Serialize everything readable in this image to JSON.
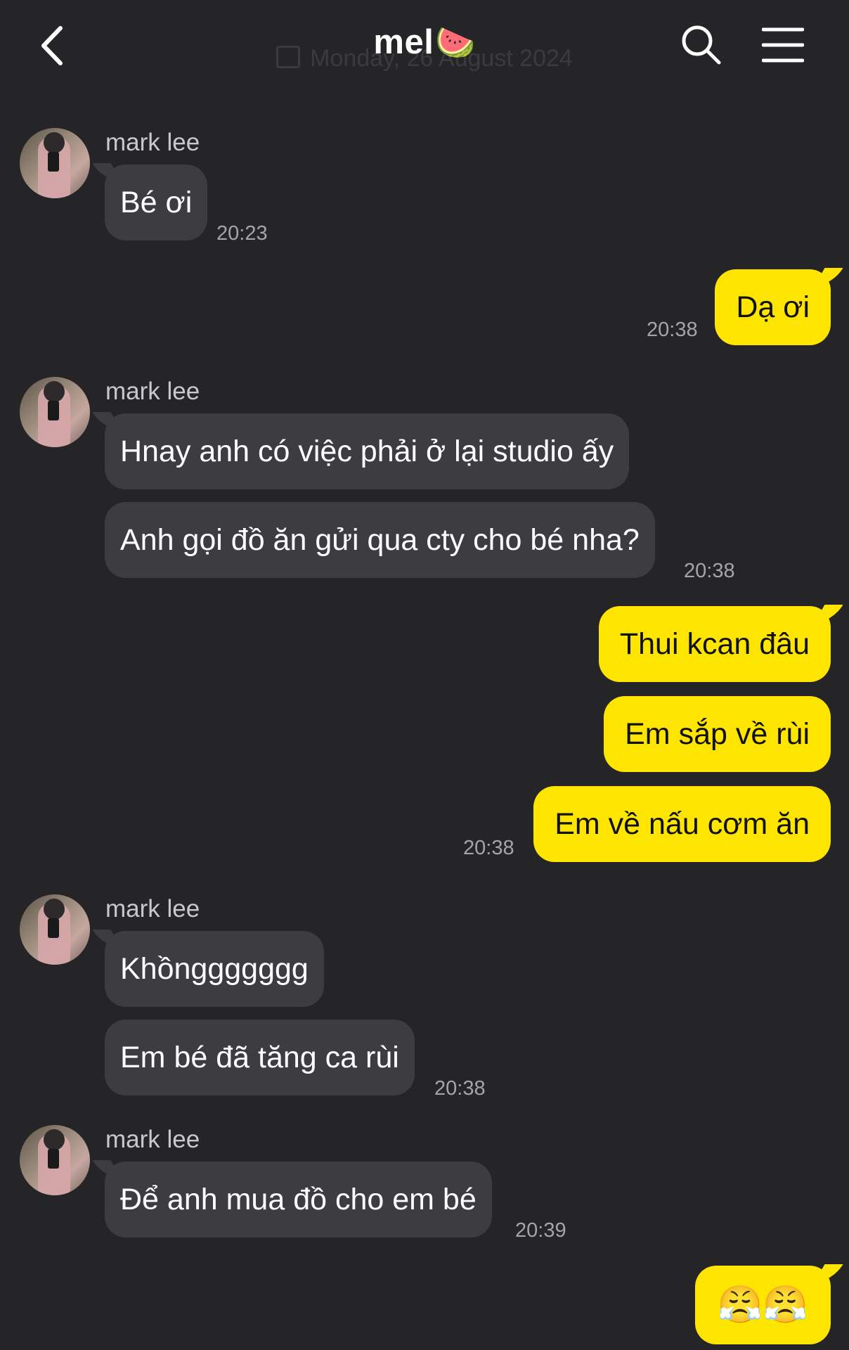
{
  "header": {
    "title": "mel",
    "title_emoji": "🍉",
    "date_divider": "Monday, 26 August 2024",
    "back_icon": "chevron-left-icon",
    "search_icon": "search-icon",
    "menu_icon": "hamburger-menu-icon"
  },
  "colors": {
    "background": "#252528",
    "incoming_bubble": "#3d3d41",
    "outgoing_bubble": "#fde500"
  },
  "messages": [
    {
      "direction": "in",
      "sender": "mark lee",
      "texts": [
        "Bé ơi"
      ],
      "time": "20:23"
    },
    {
      "direction": "out",
      "texts": [
        "Dạ ơi"
      ],
      "time": "20:38"
    },
    {
      "direction": "in",
      "sender": "mark lee",
      "texts": [
        "Hnay anh có việc phải ở lại studio ấy",
        "Anh gọi đồ ăn gửi qua cty cho bé nha?"
      ],
      "time": "20:38"
    },
    {
      "direction": "out",
      "texts": [
        "Thui kcan đâu",
        "Em sắp về rùi",
        "Em về nấu cơm ăn"
      ],
      "time": "20:38"
    },
    {
      "direction": "in",
      "sender": "mark lee",
      "texts": [
        "Khồnggggggg",
        "Em bé đã tăng ca rùi"
      ],
      "time": "20:38"
    },
    {
      "direction": "in",
      "sender": "mark lee",
      "texts": [
        "Để anh mua đồ cho em bé"
      ],
      "time": "20:39"
    },
    {
      "direction": "out",
      "texts": [
        "😤😤"
      ]
    }
  ]
}
